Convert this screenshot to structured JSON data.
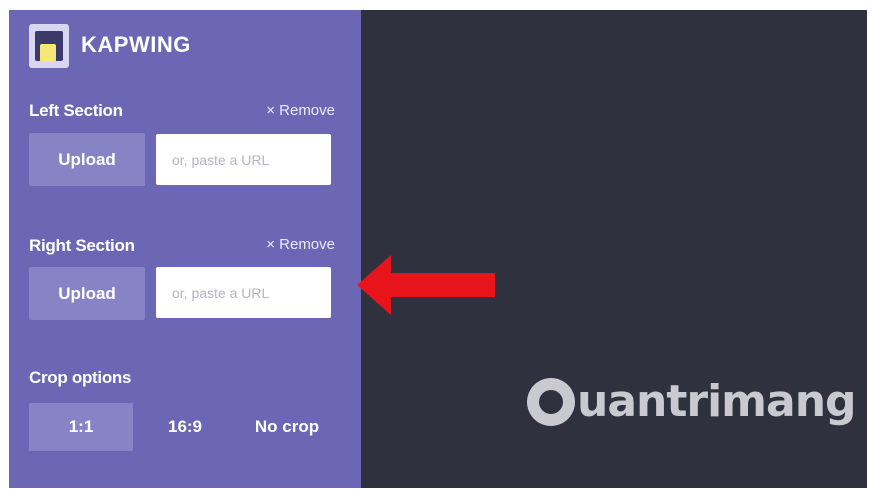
{
  "brand": "KAPWING",
  "left_section": {
    "title": "Left Section",
    "remove_label": "Remove",
    "upload_label": "Upload",
    "url_placeholder": "or, paste a URL"
  },
  "right_section": {
    "title": "Right Section",
    "remove_label": "Remove",
    "upload_label": "Upload",
    "url_placeholder": "or, paste a URL"
  },
  "crop": {
    "title": "Crop options",
    "options": [
      "1:1",
      "16:9",
      "No crop"
    ],
    "selected": "1:1"
  },
  "watermark": {
    "text": "uantrimang"
  },
  "colors": {
    "sidebar": "#6b67b4",
    "button": "#8784c6",
    "canvas": "#2f323e",
    "arrow": "#e8141b"
  }
}
